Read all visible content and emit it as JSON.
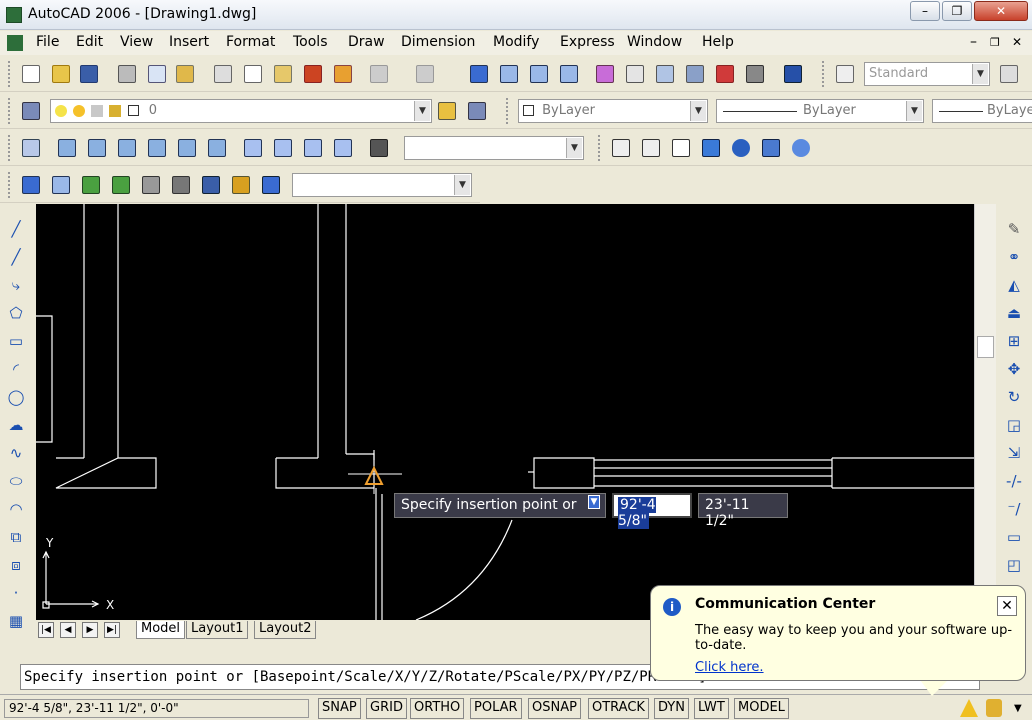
{
  "window": {
    "title": "AutoCAD 2006 - [Drawing1.dwg]",
    "min_btn": "–",
    "max_btn": "❐",
    "close_btn": "✕"
  },
  "menu": {
    "items": [
      "File",
      "Edit",
      "View",
      "Insert",
      "Format",
      "Tools",
      "Draw",
      "Dimension",
      "Modify",
      "Express",
      "Window",
      "Help"
    ],
    "doc_min": "–",
    "doc_max": "❐",
    "doc_close": "✕"
  },
  "toolbar_standard": {
    "text_style": "Standard"
  },
  "toolbar_layers": {
    "current_layer": "0",
    "color": "ByLayer",
    "linetype": "ByLayer",
    "lineweight": "ByLaye"
  },
  "layout_tabs": {
    "tabs": [
      "Model",
      "Layout1",
      "Layout2"
    ]
  },
  "canvas": {
    "ucs_x": "X",
    "ucs_y": "Y"
  },
  "dynamic_input": {
    "prompt": "Specify insertion point or",
    "x_value": "92'-4 5/8\"",
    "y_value": "23'-11 1/2\""
  },
  "command_line": {
    "text": "Specify insertion point or [Basepoint/Scale/X/Y/Z/Rotate/PScale/PX/PY/PZ/PRotate]:"
  },
  "status_bar": {
    "coordinates": "92'-4 5/8\",  23'-11 1/2\", 0'-0\"",
    "buttons": [
      "SNAP",
      "GRID",
      "ORTHO",
      "POLAR",
      "OSNAP",
      "OTRACK",
      "DYN",
      "LWT",
      "MODEL"
    ]
  },
  "communication_center": {
    "title": "Communication Center",
    "message": "The easy way to keep you and your software up-to-date.",
    "link": "Click here.",
    "close": "✕"
  },
  "colors": {
    "canvas_bg": "#000000",
    "tooltip_bg": "#3a3a48",
    "balloon_bg": "#ffffe1",
    "link": "#0033cc"
  }
}
